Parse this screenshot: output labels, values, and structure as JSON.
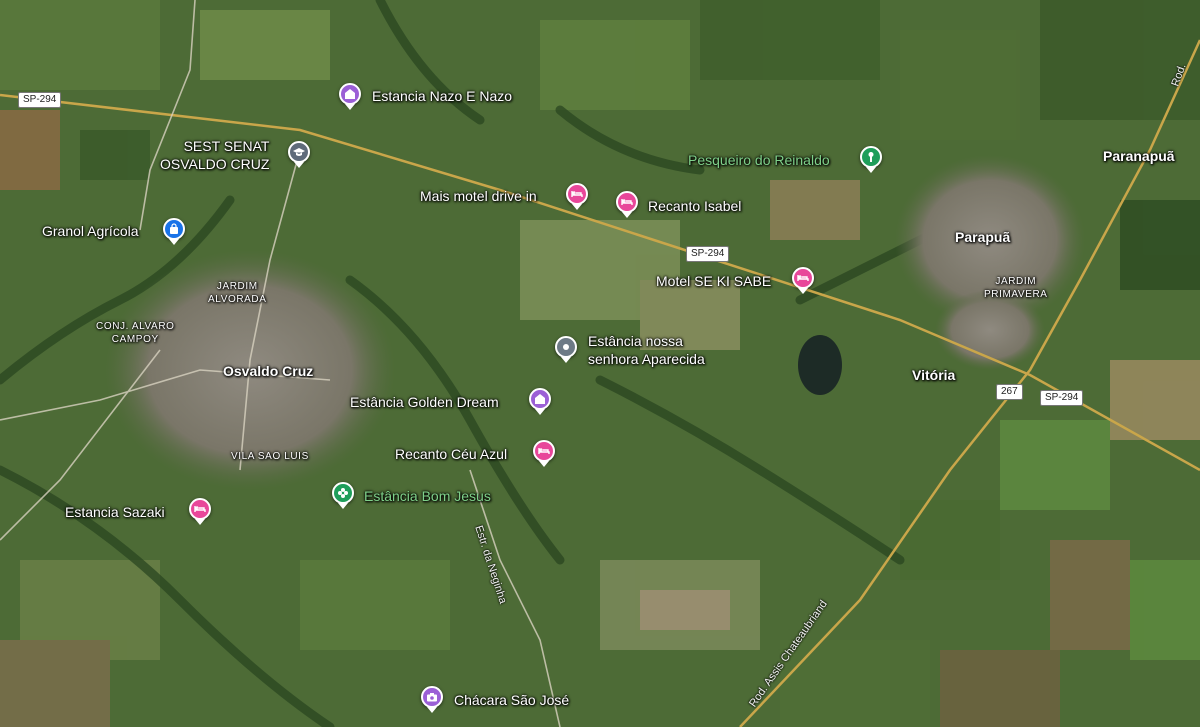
{
  "colors": {
    "lodging": "#e8479a",
    "attraction": "#9b5fd6",
    "park": "#1e9e5a",
    "shopping": "#1a73e8",
    "school": "#5f6b7a",
    "generic": "#6d7a86",
    "road": "#c9a64a"
  },
  "places": {
    "estancia_nazo": {
      "label": "Estancia Nazo E Nazo",
      "icon": "attraction-icon"
    },
    "sest_senat": {
      "label": "SEST SENAT\nOSVALDO CRUZ",
      "icon": "school-icon"
    },
    "pesqueiro": {
      "label": "Pesqueiro do Reinaldo",
      "icon": "park-icon"
    },
    "paranapua": {
      "label": "Paranapuã"
    },
    "mais_motel": {
      "label": "Mais motel drive in",
      "icon": "bed-icon"
    },
    "recanto_isabel": {
      "label": "Recanto Isabel",
      "icon": "bed-icon"
    },
    "granol": {
      "label": "Granol Agrícola",
      "icon": "shopping-bag-icon"
    },
    "parapua": {
      "label": "Parapuã"
    },
    "jardim_alvorada": {
      "label": "JARDIM\nALVORADA"
    },
    "jardim_primavera": {
      "label": "JARDIM\nPRIMAVERA"
    },
    "motel_seki": {
      "label": "Motel SE KI SABE",
      "icon": "bed-icon"
    },
    "conj_alvaro": {
      "label": "CONJ. ALVARO\nCAMPOY"
    },
    "estancia_nossa": {
      "label": "Estância nossa\nsenhora Aparecida",
      "icon": "location-pin-icon"
    },
    "osvaldo_cruz": {
      "label": "Osvaldo Cruz"
    },
    "vitoria": {
      "label": "Vitória"
    },
    "golden_dream": {
      "label": "Estância Golden Dream",
      "icon": "attraction-icon"
    },
    "recanto_ceu": {
      "label": "Recanto Céu Azul",
      "icon": "bed-icon"
    },
    "vila_sao_luis": {
      "label": "VILA SAO LUIS"
    },
    "bom_jesus": {
      "label": "Estância Bom Jesus",
      "icon": "flower-icon"
    },
    "sazaki": {
      "label": "Estancia Sazaki",
      "icon": "bed-icon"
    },
    "chacara": {
      "label": "Chácara São José",
      "icon": "camera-icon"
    }
  },
  "roads": {
    "sp294_a": "SP-294",
    "sp294_b": "SP-294",
    "sp294_c": "SP-294",
    "r267": "267",
    "estr_neginha": "Estr. da Neginha",
    "rod_assis": "Rod. Assis Chateaubriand",
    "rod_top": "Rod."
  }
}
